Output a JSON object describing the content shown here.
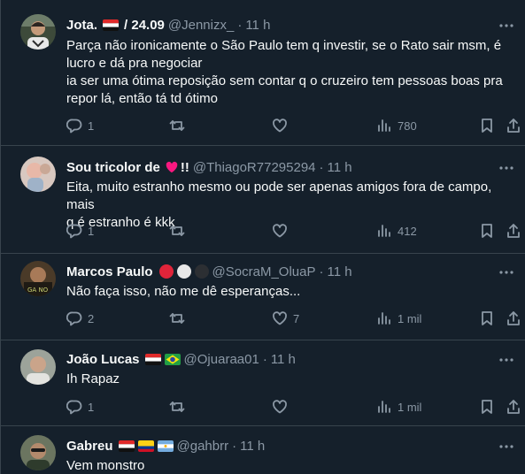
{
  "tweets": [
    {
      "name": "Jota.",
      "name_suffix": "/ 24.09",
      "handle": "@Jennizx_",
      "time": "11 h",
      "text_lines": [
        "Parça não ironicamente o São Paulo tem q investir, se o Rato sair msm, é",
        "lucro e dá pra negociar",
        "ia ser uma ótima reposição sem contar q o cruzeiro tem pessoas boas pra",
        "repor lá, então tá td ótimo"
      ],
      "replies": "1",
      "retweets": "",
      "likes": "",
      "views": "780"
    },
    {
      "name": "Sou tricolor de",
      "name_suffix": "!!",
      "handle": "@ThiagoR77295294",
      "time": "11 h",
      "text_lines": [
        "Eita, muito estranho mesmo ou pode ser apenas amigos fora de campo, mais",
        "q é estranho é kkk"
      ],
      "replies": "1",
      "retweets": "",
      "likes": "",
      "views": "412"
    },
    {
      "name": "Marcos Paulo",
      "handle": "@SocraM_OluaP",
      "time": "11 h",
      "text_lines": [
        "Não faça isso, não me dê esperanças..."
      ],
      "replies": "2",
      "retweets": "",
      "likes": "7",
      "views": "1 mil"
    },
    {
      "name": "João Lucas",
      "handle": "@Ojuaraa01",
      "time": "11 h",
      "text_lines": [
        "Ih Rapaz"
      ],
      "replies": "1",
      "retweets": "",
      "likes": "",
      "views": "1 mil"
    },
    {
      "name": "Gabreu",
      "handle": "@gahbrr",
      "time": "11 h",
      "text_lines": [
        "Vem monstro"
      ]
    }
  ],
  "separator": "·",
  "colors": {
    "background": "#15202b",
    "border": "#38444d",
    "text": "#f7f9f9",
    "secondary": "#8b98a5",
    "heart": "#f91880"
  },
  "icons": [
    "more-icon",
    "reply-icon",
    "retweet-icon",
    "like-icon",
    "views-icon",
    "bookmark-icon",
    "share-icon"
  ]
}
